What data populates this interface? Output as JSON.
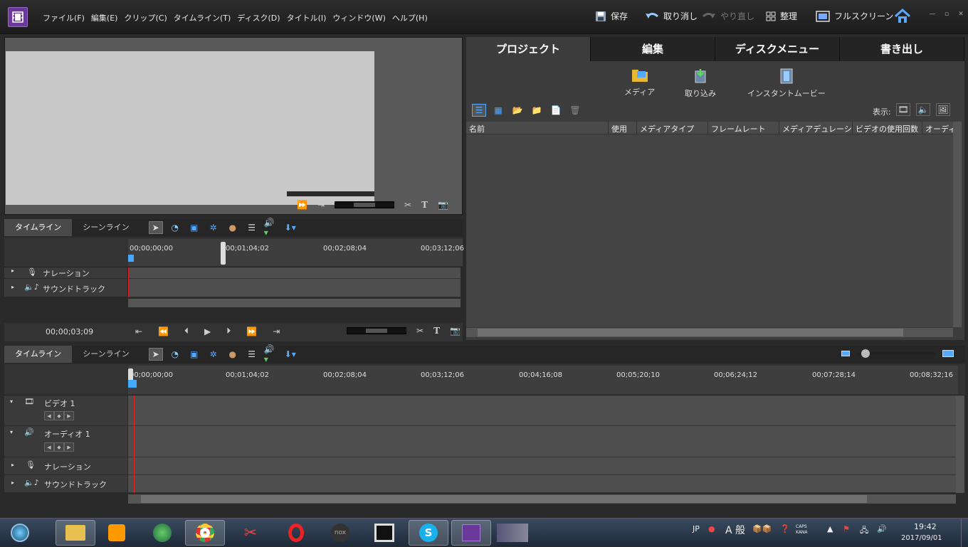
{
  "menu": [
    "ファイル(F)",
    "編集(E)",
    "クリップ(C)",
    "タイムライン(T)",
    "ディスク(D)",
    "タイトル(I)",
    "ウィンドウ(W)",
    "ヘルプ(H)"
  ],
  "toolbar": {
    "save": "保存",
    "undo": "取り消し",
    "redo": "やり直し",
    "organize": "整理",
    "fullscreen": "フルスクリーン"
  },
  "monitor": {
    "timecode": "00;00;03;09"
  },
  "timeline_tabs": {
    "timeline": "タイムライン",
    "sceneline": "シーンライン"
  },
  "small_ruler": [
    "00;00;00;00",
    "00;01;04;02",
    "00;02;08;04",
    "00;03;12;06"
  ],
  "small_tracks": {
    "narration": "ナレーション",
    "soundtrack": "サウンドトラック"
  },
  "right_tabs": [
    "プロジェクト",
    "編集",
    "ディスクメニュー",
    "書き出し"
  ],
  "project_tools": {
    "media": "メディア",
    "import": "取り込み",
    "instant_movie": "インスタントムービー"
  },
  "view_label": "表示:",
  "columns": [
    "名前",
    "使用",
    "メディアタイプ",
    "フレームレート",
    "メディアデュレーション",
    "ビデオの使用回数",
    "オーディオ"
  ],
  "big_ruler": [
    "00;00;00;00",
    "00;01;04;02",
    "00;02;08;04",
    "00;03;12;06",
    "00;04;16;08",
    "00;05;20;10",
    "00;06;24;12",
    "00;07;28;14",
    "00;08;32;16"
  ],
  "tracks": {
    "video1": "ビデオ 1",
    "audio1": "オーディオ 1",
    "narration": "ナレーション",
    "soundtrack": "サウンドトラック"
  },
  "tray": {
    "lang": "JP",
    "ime": "A 般",
    "caps": "CAPS",
    "kana": "KANA",
    "time": "19:42",
    "date": "2017/09/01"
  },
  "colors": {
    "playhead": "#dd2222",
    "accent": "#6a3a9a"
  }
}
